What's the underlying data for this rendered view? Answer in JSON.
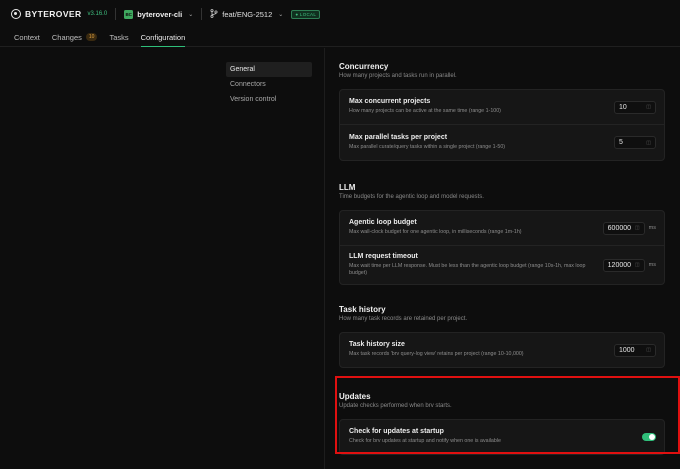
{
  "app": {
    "name": "BYTEROVER",
    "version": "v3.16.0",
    "project_badge": "BC",
    "project_name": "byterover-cli",
    "branch_name": "feat/ENG-2512",
    "local_badge": "LOCAL"
  },
  "tabs": [
    {
      "label": "Context"
    },
    {
      "label": "Changes",
      "count": "10"
    },
    {
      "label": "Tasks"
    },
    {
      "label": "Configuration",
      "active": true
    }
  ],
  "nav": [
    {
      "label": "General",
      "active": true
    },
    {
      "label": "Connectors"
    },
    {
      "label": "Version control"
    }
  ],
  "sections": {
    "concurrency": {
      "title": "Concurrency",
      "subtitle": "How many projects and tasks run in parallel.",
      "rows": [
        {
          "label": "Max concurrent projects",
          "desc": "How many projects can be active at the same time (range 1-100)",
          "value": "10"
        },
        {
          "label": "Max parallel tasks per project",
          "desc": "Max parallel curate/query tasks within a single project (range 1-50)",
          "value": "5"
        }
      ]
    },
    "llm": {
      "title": "LLM",
      "subtitle": "Time budgets for the agentic loop and model requests.",
      "rows": [
        {
          "label": "Agentic loop budget",
          "desc": "Max wall-clock budget for one agentic loop, in milliseconds (range 1m-1h)",
          "value": "600000",
          "unit": "ms"
        },
        {
          "label": "LLM request timeout",
          "desc": "Max wait time per LLM response. Must be less than the agentic loop budget (range 10s-1h, max loop budget)",
          "value": "120000",
          "unit": "ms"
        }
      ]
    },
    "task_history": {
      "title": "Task history",
      "subtitle": "How many task records are retained per project.",
      "rows": [
        {
          "label": "Task history size",
          "desc": "Max task records 'brv query-log view' retains per project (range 10-10,000)",
          "value": "1000"
        }
      ]
    },
    "updates": {
      "title": "Updates",
      "subtitle": "Update checks performed when brv starts.",
      "rows": [
        {
          "label": "Check for updates at startup",
          "desc": "Check for brv updates at startup and notify when one is available",
          "enabled": true
        }
      ]
    }
  },
  "icons": {
    "logo": "byterover-logo-icon",
    "chevron": "chevron-down-icon",
    "branch": "git-branch-icon",
    "stepper": "stepper-icon"
  },
  "colors": {
    "accent": "#2fbf7a",
    "highlight": "#e01010",
    "changes_badge": "#e0a040"
  }
}
